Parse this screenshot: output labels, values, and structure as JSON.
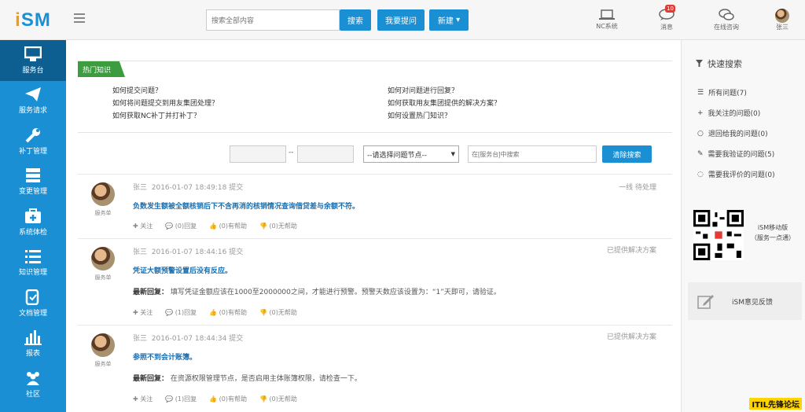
{
  "logo": {
    "i": "i",
    "sm": "SM"
  },
  "header": {
    "search_placeholder": "搜索全部内容",
    "search_button": "搜索",
    "ask_button": "我要提问",
    "new_button": "新建",
    "nc_system": "NC系统",
    "messages": "消息",
    "message_count": "10",
    "consult": "在线咨询",
    "user": "张三"
  },
  "sidebar": {
    "items": [
      {
        "label": "服务台",
        "icon": "monitor-icon"
      },
      {
        "label": "服务请求",
        "icon": "paper-plane-icon"
      },
      {
        "label": "补丁管理",
        "icon": "wrench-icon"
      },
      {
        "label": "变更管理",
        "icon": "server-icon"
      },
      {
        "label": "系统体检",
        "icon": "medical-kit-icon"
      },
      {
        "label": "知识管理",
        "icon": "list-icon"
      },
      {
        "label": "文档管理",
        "icon": "document-icon"
      },
      {
        "label": "报表",
        "icon": "bar-chart-icon"
      },
      {
        "label": "社区",
        "icon": "users-icon"
      }
    ]
  },
  "hot": {
    "tag": "热门知识",
    "links": [
      "如何提交问题？",
      "如何对问题进行回复？",
      "如何将问题提交到用友集团处理？",
      "如何获取用友集团提供的解决方案？",
      "如何获取NC补丁并打补丁？",
      "如何设置热门知识？"
    ]
  },
  "filter": {
    "range_sep": "--",
    "select": "--请选择问题节点--",
    "keyword_placeholder": "在[服务台]中搜索",
    "clear_button": "清除搜索"
  },
  "posts": [
    {
      "author": "张三",
      "time": "2016-01-07 18:49:18 提交",
      "status": "一线 待处理",
      "title": "负数发生额被全额核销后下不含再消的核销情况查询借贷差与余额不符。",
      "reply_label": "",
      "reply": "",
      "avatar_label": "服务单",
      "actions": [
        "关注",
        "(0)回复",
        "(0)有帮助",
        "(0)无帮助"
      ]
    },
    {
      "author": "张三",
      "time": "2016-01-07 18:44:16 提交",
      "status": "已提供解决方案",
      "title": "凭证大额预警设置后没有反应。",
      "reply_label": "最新回复：",
      "reply": "填写凭证金额应该在1000至2000000之间，才能进行预警。预警天数应该设置为：“1”天即可，请验证。",
      "avatar_label": "服务单",
      "actions": [
        "关注",
        "(1)回复",
        "(0)有帮助",
        "(0)无帮助"
      ]
    },
    {
      "author": "张三",
      "time": "2016-01-07 18:44:34 提交",
      "status": "已提供解决方案",
      "title": "参照不到会计账簿。",
      "reply_label": "最新回复：",
      "reply": "在资源权限管理节点，是否启用主体账簿权限，请检查一下。",
      "avatar_label": "服务单",
      "actions": [
        "关注",
        "(1)回复",
        "(0)有帮助",
        "(0)无帮助"
      ]
    }
  ],
  "right": {
    "title": "快速搜索",
    "items": [
      {
        "label": "所有问题(7)",
        "icon": "list-icon"
      },
      {
        "label": "我关注的问题(0)",
        "icon": "plus-icon"
      },
      {
        "label": "退回给我的问题(0)",
        "icon": "circle-icon"
      },
      {
        "label": "需要我验证的问题(5)",
        "icon": "pencil-icon"
      },
      {
        "label": "需要我评价的问题(0)",
        "icon": "comment-icon"
      }
    ],
    "app_label": "iSM移动版",
    "app_sub": "（服务一点通）",
    "feedback": "iSM意见反馈"
  },
  "watermark": "ITIL先锋论坛",
  "colors": {
    "brand_blue": "#1a8fd4",
    "active_nav": "#0d5f92",
    "hot_green": "#3b9d3f",
    "orange": "#f39a12"
  }
}
